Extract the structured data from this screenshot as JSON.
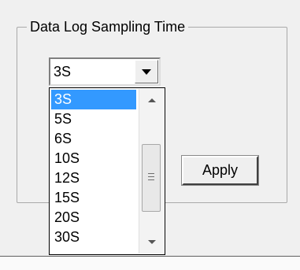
{
  "group": {
    "title": "Data Log Sampling Time"
  },
  "combo": {
    "value": "3S",
    "button_icon": "chevron-down-icon"
  },
  "dropdown": {
    "items": [
      "3S",
      "5S",
      "6S",
      "10S",
      "12S",
      "15S",
      "20S",
      "30S"
    ],
    "selected_index": 0,
    "scroll_up_icon": "scroll-up-arrow-icon",
    "scroll_down_icon": "scroll-down-arrow-icon"
  },
  "apply_label": "Apply",
  "colors": {
    "selection": "#3399ff",
    "background": "#f0f0f0"
  }
}
